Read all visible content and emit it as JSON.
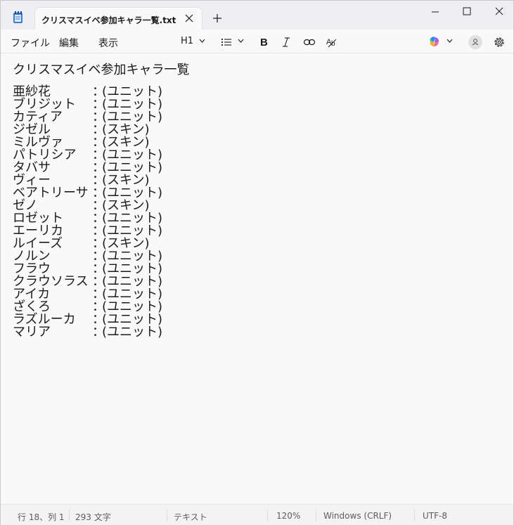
{
  "titlebar": {
    "tab_title": "クリスマスイベ参加キャラ一覧.txt"
  },
  "icons": {
    "app": "notepad-icon",
    "tab_close": "close-icon",
    "new_tab": "plus-icon",
    "minimize": "minimize-icon",
    "maximize": "maximize-icon",
    "close": "close-icon",
    "copilot": "copilot-icon",
    "account": "account-icon",
    "settings": "gear-icon"
  },
  "menu": {
    "file": "ファイル",
    "edit": "編集",
    "view": "表示"
  },
  "toolbar": {
    "heading": "H1"
  },
  "document": {
    "title": "クリスマスイベ参加キャラ一覧",
    "separator": "：",
    "rows": [
      {
        "name": "亜紗花",
        "type": "(ユニット)"
      },
      {
        "name": "ブリジット",
        "type": "(ユニット)"
      },
      {
        "name": "カティア",
        "type": "(ユニット)"
      },
      {
        "name": "ジゼル",
        "type": "(スキン)"
      },
      {
        "name": "ミルヴァ",
        "type": "(スキン)"
      },
      {
        "name": "パトリシア",
        "type": "(ユニット)"
      },
      {
        "name": "タバサ",
        "type": "(ユニット)"
      },
      {
        "name": "ヴィー",
        "type": "(スキン)"
      },
      {
        "name": "ベアトリーサ",
        "type": "(ユニット)"
      },
      {
        "name": "ゼノ",
        "type": "(スキン)"
      },
      {
        "name": "ロゼット",
        "type": "(ユニット)"
      },
      {
        "name": "エーリカ",
        "type": "(ユニット)"
      },
      {
        "name": "ルイーズ",
        "type": "(スキン)"
      },
      {
        "name": "ノルン",
        "type": "(ユニット)"
      },
      {
        "name": "フラウ",
        "type": "(ユニット)"
      },
      {
        "name": "クラウソラス",
        "type": "(ユニット)"
      },
      {
        "name": "アイカ",
        "type": "(ユニット)"
      },
      {
        "name": "ざくろ",
        "type": "(ユニット)"
      },
      {
        "name": "ラズルーカ",
        "type": "(ユニット)"
      },
      {
        "name": "マリア",
        "type": "(ユニット)"
      }
    ]
  },
  "status": {
    "position": "行 18、列 1",
    "chars": "293 文字",
    "format": "テキスト",
    "zoom": "120%",
    "line_ending": "Windows (CRLF)",
    "encoding": "UTF-8"
  }
}
